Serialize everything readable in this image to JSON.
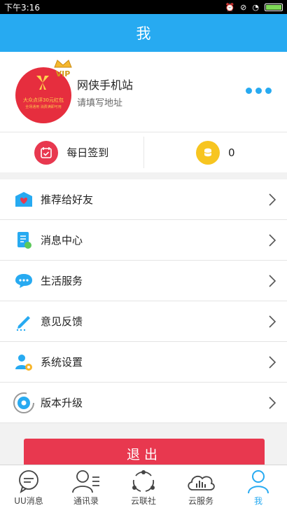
{
  "status": {
    "time": "下午3:16"
  },
  "header": {
    "title": "我"
  },
  "profile": {
    "name": "网侠手机站",
    "address": "请填写地址",
    "avatar_text_1": "大众点评30元红包",
    "avatar_text_2": "全场通用 消费满即可用",
    "vip_label": "VIP"
  },
  "quick": {
    "checkin_label": "每日签到",
    "coins_value": "0"
  },
  "menu": {
    "items": [
      {
        "label": "推荐给好友",
        "icon": "recommend-icon"
      },
      {
        "label": "消息中心",
        "icon": "message-center-icon"
      },
      {
        "label": "生活服务",
        "icon": "life-service-icon"
      },
      {
        "label": "意见反馈",
        "icon": "feedback-icon"
      },
      {
        "label": "系统设置",
        "icon": "settings-icon"
      },
      {
        "label": "版本升级",
        "icon": "upgrade-icon"
      }
    ]
  },
  "logout_label": "退出",
  "tabs": [
    {
      "label": "UU消息",
      "icon": "chat-icon",
      "active": false
    },
    {
      "label": "通讯录",
      "icon": "contacts-icon",
      "active": false
    },
    {
      "label": "云联社",
      "icon": "cloud-community-icon",
      "active": false
    },
    {
      "label": "云服务",
      "icon": "cloud-service-icon",
      "active": false
    },
    {
      "label": "我",
      "icon": "me-icon",
      "active": true
    }
  ],
  "colors": {
    "primary": "#27aaf1",
    "logout": "#e8384f",
    "avatar": "#e62e3e"
  }
}
